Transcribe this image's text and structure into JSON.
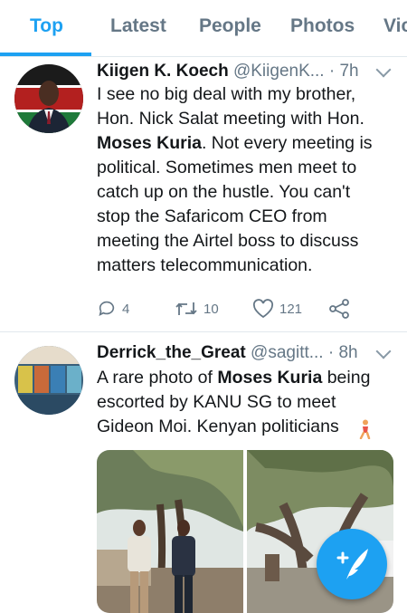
{
  "tabs": [
    "Top",
    "Latest",
    "People",
    "Photos",
    "Vic"
  ],
  "active_tab": "Top",
  "tweets": [
    {
      "name": "Kiigen K. Koech",
      "handle": "@KiigenK...",
      "time": "7h",
      "text_lines": [
        [
          "I see no big deal with my brother,"
        ],
        [
          "Hon. Nick Salat meeting with Hon."
        ],
        [
          "__BOLD__Moses Kuria",
          ". Not every meeting is"
        ],
        [
          "political. Sometimes men meet to"
        ],
        [
          "catch up on the hustle. You can't"
        ],
        [
          "stop the Safaricom CEO from"
        ],
        [
          "meeting the Airtel boss to discuss"
        ],
        [
          "matters telecommunication."
        ]
      ],
      "replies": "4",
      "retweets": "10",
      "likes": "121"
    },
    {
      "name": "Derrick_the_Great",
      "handle": "@sagitt...",
      "time": "8h",
      "text_lines": [
        [
          "A rare photo of ",
          "__BOLD__Moses Kuria",
          " being"
        ],
        [
          "escorted by KANU SG to meet"
        ],
        [
          "Gideon Moi. Kenyan politicians"
        ]
      ],
      "emoji_name": "person-walking-emoji"
    }
  ],
  "icons": {
    "reply": "reply-icon",
    "retweet": "retweet-icon",
    "like": "heart-icon",
    "share": "share-icon",
    "compose": "compose-tweet-icon"
  },
  "colors": {
    "accent": "#1da1f2",
    "text": "#14171a",
    "secondary": "#657786",
    "divider": "#e1e8ed"
  }
}
